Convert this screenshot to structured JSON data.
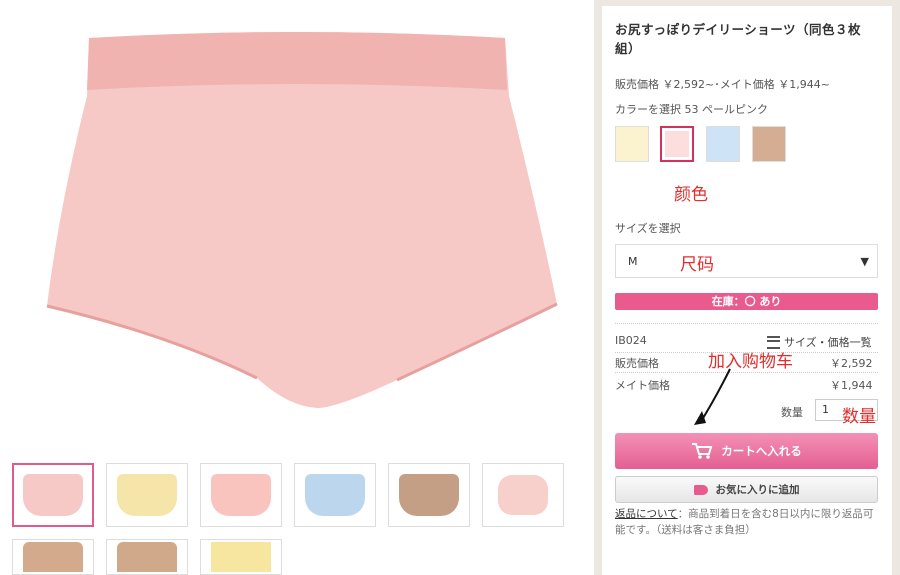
{
  "product": {
    "title": "お尻すっぽりデイリーショーツ（同色３枚組）",
    "price_line": "販売価格 ￥2,592~･メイト価格 ￥1,944~",
    "color_label": "カラーを選択 53 ペールピンク",
    "colors": [
      "#fbf2cf",
      "#fcdede",
      "#cfe3f6",
      "#d5ad93"
    ],
    "color_annotation": "颜色",
    "size_label": "サイズを選択",
    "size_value": "M",
    "size_annotation": "尺码",
    "stock_text": "在庫：〇 あり",
    "code": "IB024",
    "size_price_link": "サイズ・価格一覧",
    "sale_price_label": "販売価格",
    "sale_price_value": "￥2,592",
    "member_price_label": "メイト価格",
    "member_price_value": "￥1,944",
    "cart_annotation": "加入购物车",
    "qty_label": "数量",
    "qty_value": "1",
    "qty_annotation": "数量",
    "cart_button": "カートへ入れる",
    "fav_button": "お気に入りに追加",
    "return_link": "返品について",
    "return_text": "：商品到着日を含む8日以内に限り返品可能です。（送料は客さま負担）"
  },
  "thumbnails": [
    "#f6c9c6",
    "#f5e5a8",
    "#f8c4bd",
    "#bcd6ee",
    "#c49f85",
    "#f7cfcb",
    "#d4aa8c",
    "#cfa98a",
    "#f6e6a0"
  ],
  "accent": "#e85b8c"
}
